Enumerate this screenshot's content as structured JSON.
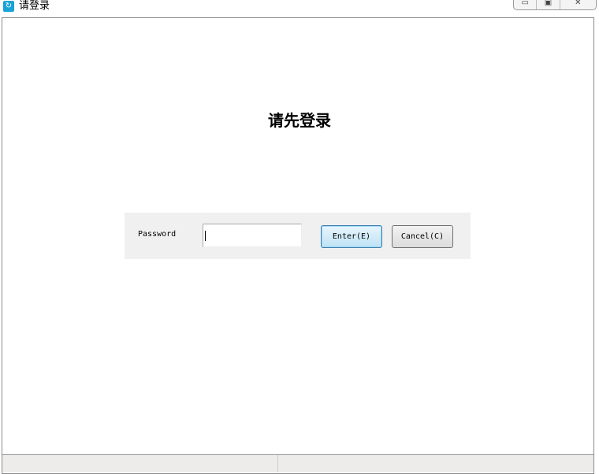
{
  "window": {
    "title": "请登录",
    "icon": "app-icon",
    "controls": {
      "minimize": "▭",
      "maximize": "▣",
      "close": "✕"
    }
  },
  "heading": "请先登录",
  "form": {
    "password_label": "Password",
    "password_value": "",
    "enter_label": "Enter(E)",
    "cancel_label": "Cancel(C)"
  }
}
